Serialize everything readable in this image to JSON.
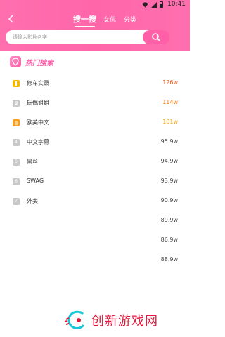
{
  "status_bar": {
    "time": "10:41"
  },
  "nav": {
    "tabs": [
      {
        "label": "搜一搜",
        "active": true
      },
      {
        "label": "女优",
        "active": false
      },
      {
        "label": "分类",
        "active": false
      }
    ]
  },
  "search": {
    "placeholder": "请输入影片名字"
  },
  "hot": {
    "title": "热门搜索",
    "items": [
      {
        "rank": "1",
        "name": "修车实录",
        "value": "126w"
      },
      {
        "rank": "2",
        "name": "玩偶姐姐",
        "value": "114w"
      },
      {
        "rank": "3",
        "name": "欧美中文",
        "value": "101w"
      },
      {
        "rank": "4",
        "name": "中文字幕",
        "value": "95.9w"
      },
      {
        "rank": "5",
        "name": "黑丝",
        "value": "94.9w"
      },
      {
        "rank": "6",
        "name": "SWAG",
        "value": "93.9w"
      },
      {
        "rank": "7",
        "name": "外卖",
        "value": "90.9w"
      },
      {
        "rank": "",
        "name": "",
        "value": "89.9w"
      },
      {
        "rank": "",
        "name": "",
        "value": "86.9w"
      },
      {
        "rank": "",
        "name": "",
        "value": "88.9w"
      }
    ]
  },
  "watermark": {
    "text": "创新游戏网"
  },
  "colors": {
    "brand_pink": "#ff66aa",
    "rank1": "#f5b800",
    "rank3": "#f4a020",
    "value_hot": "#ef5a14"
  }
}
